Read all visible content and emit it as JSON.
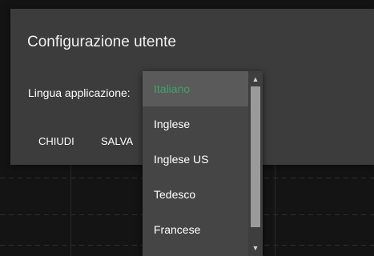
{
  "dialog": {
    "title": "Configurazione utente",
    "language_label": "Lingua applicazione:",
    "close_button": "CHIUDI",
    "save_button": "SALVA"
  },
  "language_dropdown": {
    "selected": "Italiano",
    "options": [
      "Italiano",
      "Inglese",
      "Inglese US",
      "Tedesco",
      "Francese"
    ],
    "scroll_up_icon": "triangle-up-icon",
    "scroll_down_icon": "triangle-down-icon"
  },
  "colors": {
    "dialog_bg": "#3c3c3c",
    "dropdown_bg": "#454545",
    "selected_bg": "#5a5a5a",
    "selected_text": "#3fa36b",
    "page_bg": "#141414"
  }
}
